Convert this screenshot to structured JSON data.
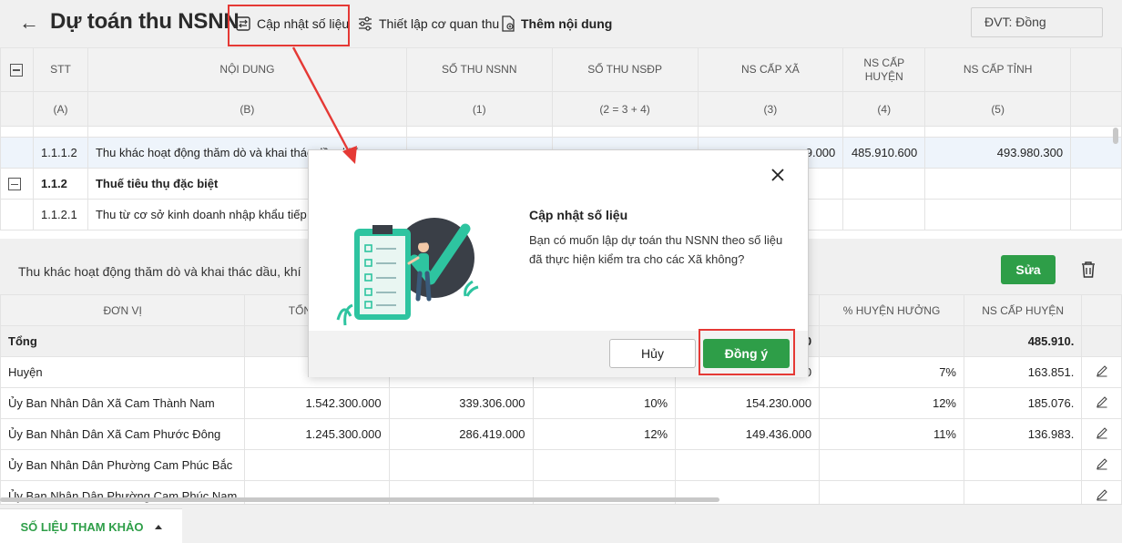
{
  "header": {
    "title": "Dự toán thu NSNN",
    "toolbar": {
      "update_label": "Cập nhật số liệu",
      "setup_label": "Thiết lập cơ quan thu",
      "add_label": "Thêm nội dung"
    },
    "unit_label": "ĐVT:  Đồng"
  },
  "top_table": {
    "headers": [
      "STT",
      "NỘI DUNG",
      "SỐ THU NSNN",
      "SỐ THU NSĐP",
      "NS CẤP XÃ",
      "NS CẤP HUYỆN",
      "NS CẤP TỈNH"
    ],
    "subheaders": [
      "(A)",
      "(B)",
      "(1)",
      "(2 = 3 + 4)",
      "(3)",
      "(4)",
      "(5)"
    ],
    "rows": [
      {
        "stt": "1.1.1.2",
        "content": "Thu khác hoạt động thăm dò và khai thác dầu, khí",
        "nsnn": "",
        "nsdp": "",
        "xa": ".9.000",
        "huyen": "485.910.600",
        "tinh": "493.980.300"
      },
      {
        "stt": "1.1.2",
        "content": "Thuế tiêu thụ đặc biệt",
        "nsnn": "",
        "nsdp": "",
        "xa": "",
        "huyen": "",
        "tinh": ""
      },
      {
        "stt": "1.1.2.1",
        "content": "Thu từ cơ sở kinh doanh nhập khẩu tiếp tục bán ra",
        "nsnn": "",
        "nsdp": "",
        "xa": "",
        "huyen": "",
        "tinh": ""
      }
    ]
  },
  "detail": {
    "title": "Thu khác hoạt động thăm dò và khai thác dầu, khí",
    "edit_label": "Sửa",
    "headers": [
      "ĐƠN VỊ",
      "TỔNG THU",
      "",
      "",
      "",
      "% HUYỆN HƯỞNG",
      "NS CẤP HUYỆN"
    ],
    "rows": [
      {
        "name": "Tổng",
        "total": "4.",
        "c3": "",
        "c4": "",
        "c5": "0",
        "pct_huyen": "",
        "ns_huyen": "485.910.",
        "is_total": true
      },
      {
        "name": "Huyện",
        "total": "1.",
        "c3": "",
        "c4": "",
        "c5": "0",
        "pct_huyen": "7%",
        "ns_huyen": "163.851."
      },
      {
        "name": "Ủy Ban Nhân Dân Xã Cam Thành Nam",
        "total": "1.542.300.000",
        "c3": "339.306.000",
        "c4": "10%",
        "c5": "154.230.000",
        "pct_huyen": "12%",
        "ns_huyen": "185.076."
      },
      {
        "name": "Ủy Ban Nhân Dân Xã Cam Phước Đông",
        "total": "1.245.300.000",
        "c3": "286.419.000",
        "c4": "12%",
        "c5": "149.436.000",
        "pct_huyen": "11%",
        "ns_huyen": "136.983."
      },
      {
        "name": "Ủy Ban Nhân Dân Phường Cam Phúc Bắc",
        "total": "",
        "c3": "",
        "c4": "",
        "c5": "",
        "pct_huyen": "",
        "ns_huyen": ""
      },
      {
        "name": "Ủy Ban Nhân Dân Phường Cam Phúc Nam",
        "total": "",
        "c3": "",
        "c4": "",
        "c5": "",
        "pct_huyen": "",
        "ns_huyen": ""
      }
    ]
  },
  "footer": {
    "tab_label": "SỐ LIỆU THAM KHẢO"
  },
  "dialog": {
    "title": "Cập nhật số liệu",
    "message": "Bạn có muốn lập dự toán thu NSNN theo số liệu đã thực hiện kiểm tra cho các Xã không?",
    "cancel_label": "Hủy",
    "ok_label": "Đồng ý"
  },
  "colors": {
    "accent_green": "#2e9e48",
    "highlight_red": "#e53935",
    "illustration_teal": "#2ec4a0"
  }
}
